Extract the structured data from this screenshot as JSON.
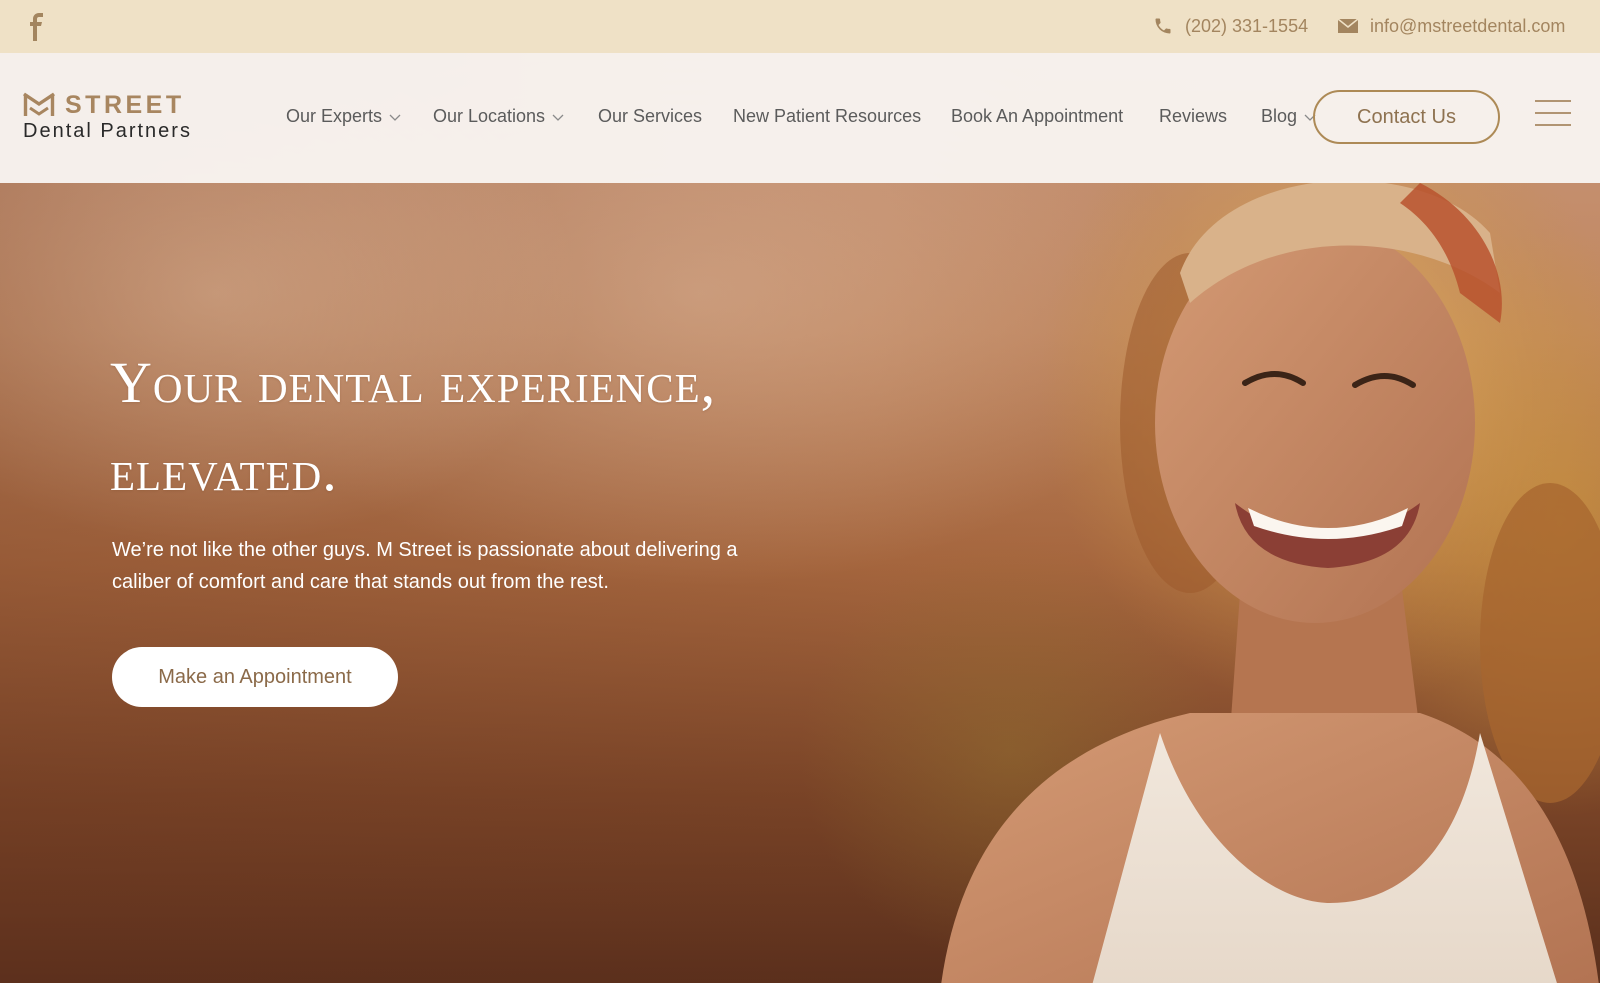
{
  "topbar": {
    "social": [
      {
        "icon": "facebook-icon"
      }
    ],
    "phone": {
      "icon": "phone-icon",
      "text": "(202) 331-1554"
    },
    "email": {
      "icon": "mail-icon",
      "text": "info@mstreetdental.com"
    }
  },
  "header": {
    "logo": {
      "icon": "m-logo-mark",
      "top": "STREET",
      "bottom": "Dental Partners"
    },
    "nav": [
      {
        "label": "Our Experts",
        "dropdown": true
      },
      {
        "label": "Our Locations",
        "dropdown": true
      },
      {
        "label": "Our Services",
        "dropdown": false
      },
      {
        "label": "New Patient Resources",
        "dropdown": false
      },
      {
        "label": "Book An Appointment",
        "dropdown": false
      },
      {
        "label": "Reviews",
        "dropdown": false
      },
      {
        "label": "Blog",
        "dropdown": true
      }
    ],
    "contact_button": "Contact Us",
    "menu_icon": "hamburger-menu-icon"
  },
  "hero": {
    "headline_line1": "Your dental experience,",
    "headline_line2": "elevated.",
    "subtext": "We’re not like the other guys. M Street is passionate about delivering a caliber of comfort and care that stands out from the rest.",
    "cta": "Make an Appointment"
  },
  "colors": {
    "topbar_bg": "#efe1c6",
    "accent": "#ad8a56",
    "nav_text": "#5b5b5b",
    "header_bg": "#f8f4f0"
  }
}
